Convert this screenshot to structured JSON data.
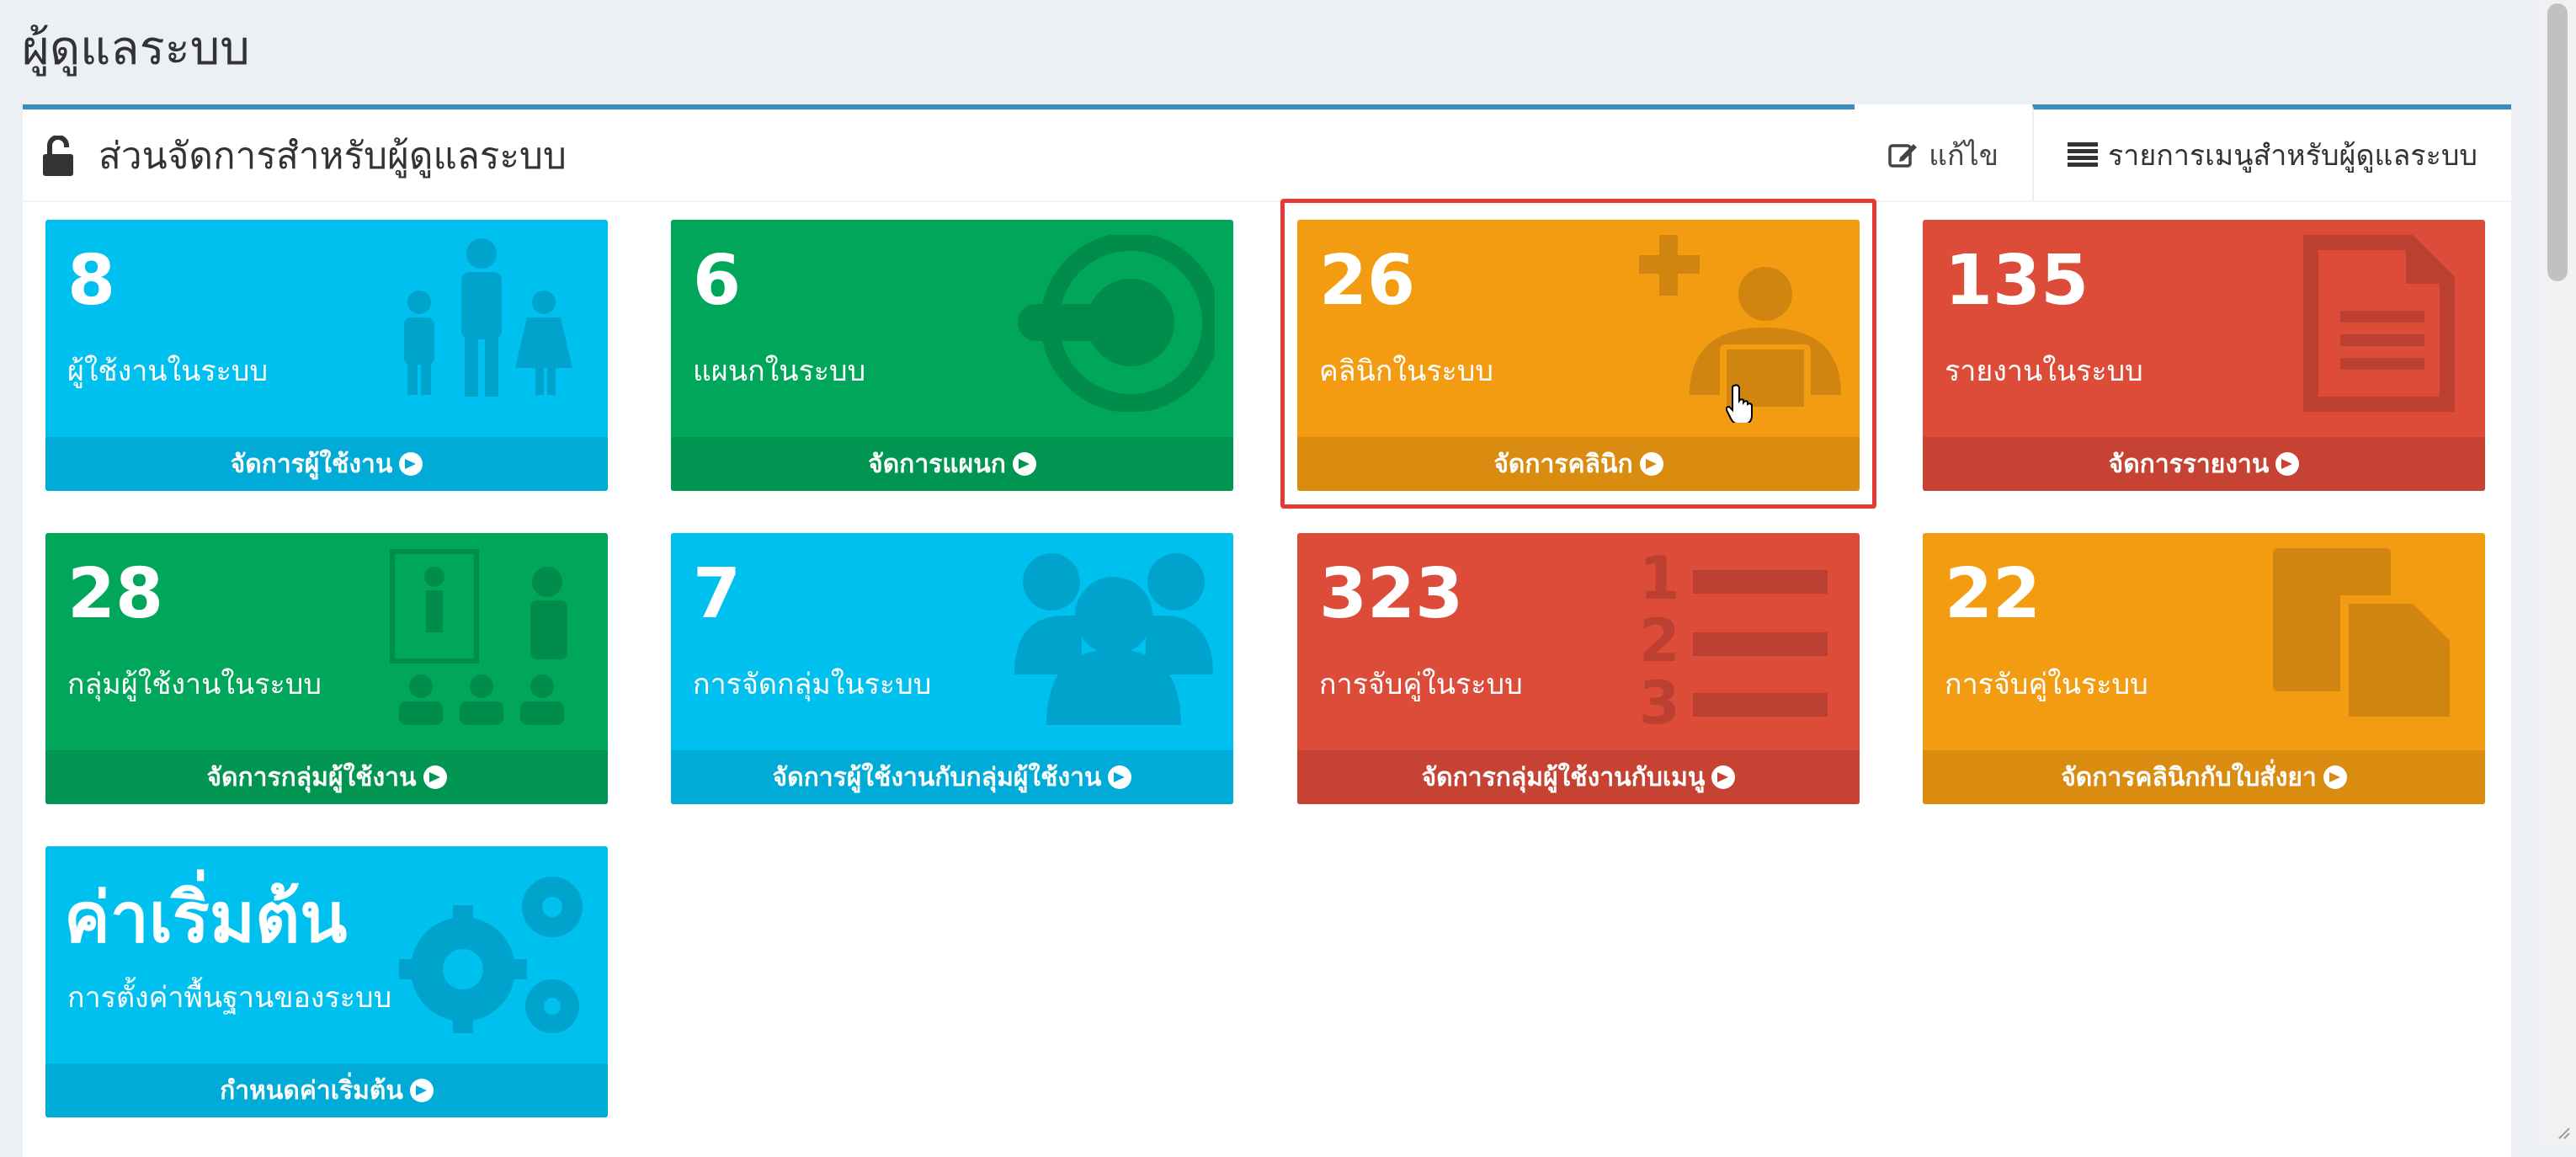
{
  "page_title": "ผู้ดูแลระบบ",
  "box": {
    "title": "ส่วนจัดการสำหรับผู้ดูแลระบบ",
    "tabs": [
      {
        "label": "แก้ไข",
        "icon": "edit-icon",
        "active": false
      },
      {
        "label": "รายการเมนูสำหรับผู้ดูแลระบบ",
        "icon": "list-icon",
        "active": true
      }
    ]
  },
  "tiles": [
    {
      "value": "8",
      "label": "ผู้ใช้งานในระบบ",
      "footer": "จัดการผู้ใช้งาน",
      "color": "#00c0ef",
      "icon": "users-standing-icon"
    },
    {
      "value": "6",
      "label": "แผนกในระบบ",
      "footer": "จัดการแผนก",
      "color": "#00a65a",
      "icon": "department-icon"
    },
    {
      "value": "26",
      "label": "คลินิกในระบบ",
      "footer": "จัดการคลินิก",
      "color": "#f39c12",
      "icon": "clinic-reader-icon"
    },
    {
      "value": "135",
      "label": "รายงานในระบบ",
      "footer": "จัดการรายงาน",
      "color": "#dd4b39",
      "icon": "document-icon"
    },
    {
      "value": "28",
      "label": "กลุ่มผู้ใช้งานในระบบ",
      "footer": "จัดการกลุ่มผู้ใช้งาน",
      "color": "#00a65a",
      "icon": "presentation-icon"
    },
    {
      "value": "7",
      "label": "การจัดกลุ่มในระบบ",
      "footer": "จัดการผู้ใช้งานกับกลุ่มผู้ใช้งาน",
      "color": "#00c0ef",
      "icon": "group-icon"
    },
    {
      "value": "323",
      "label": "การจับคู่ในระบบ",
      "footer": "จัดการกลุ่มผู้ใช้งานกับเมนู",
      "color": "#dd4b39",
      "icon": "numbered-list-icon"
    },
    {
      "value": "22",
      "label": "การจับคู่ในระบบ",
      "footer": "จัดการคลินิกกับใบสั่งยา",
      "color": "#f39c12",
      "icon": "copy-files-icon"
    },
    {
      "value": "ค่าเริ่มต้น",
      "label": "การตั้งค่าพื้นฐานของระบบ",
      "footer": "กำหนดค่าเริ่มต้น",
      "color": "#00c0ef",
      "icon": "gears-icon"
    }
  ]
}
